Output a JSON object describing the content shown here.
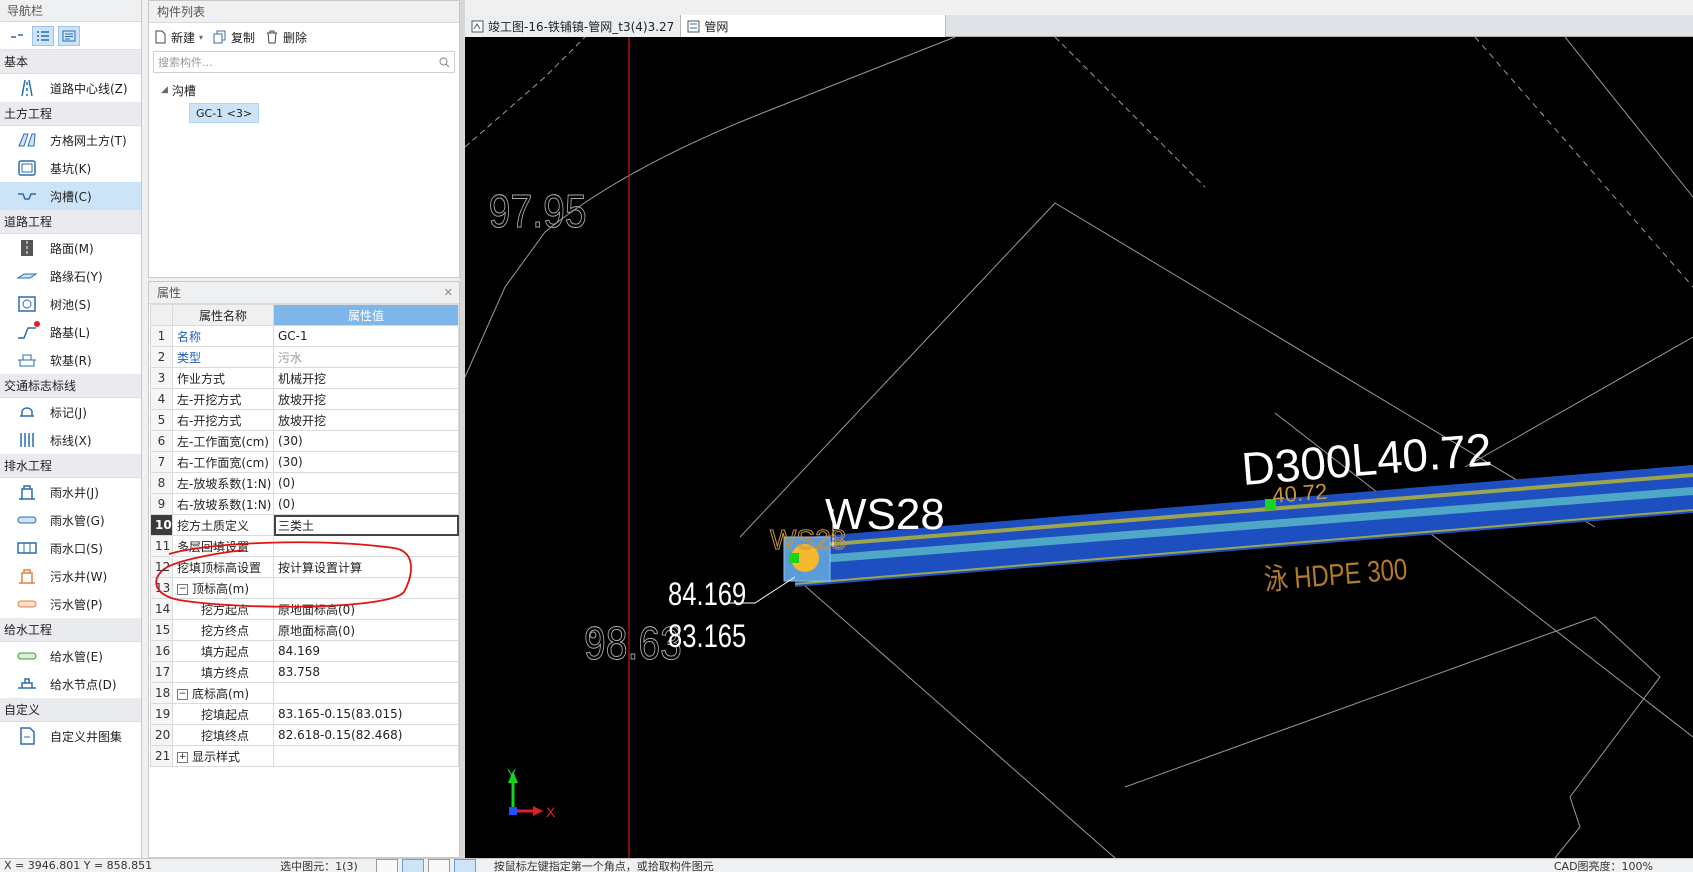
{
  "nav": {
    "title": "导航栏",
    "view_icons": [
      "collapse-icon",
      "list-view-icon",
      "detail-view-icon"
    ],
    "categories": [
      {
        "label": "基本",
        "items": [
          {
            "label": "道路中心线(Z)",
            "icon": "road-centerline-icon"
          }
        ]
      },
      {
        "label": "土方工程",
        "items": [
          {
            "label": "方格网土方(T)",
            "icon": "grid-earthwork-icon"
          },
          {
            "label": "基坑(K)",
            "icon": "foundation-pit-icon"
          },
          {
            "label": "沟槽(C)",
            "icon": "trench-icon",
            "selected": true
          }
        ]
      },
      {
        "label": "道路工程",
        "items": [
          {
            "label": "路面(M)",
            "icon": "pavement-icon"
          },
          {
            "label": "路缘石(Y)",
            "icon": "curb-icon"
          },
          {
            "label": "树池(S)",
            "icon": "tree-pit-icon"
          },
          {
            "label": "路基(L)",
            "icon": "subgrade-icon",
            "badge": true
          },
          {
            "label": "软基(R)",
            "icon": "soft-foundation-icon"
          }
        ]
      },
      {
        "label": "交通标志标线",
        "items": [
          {
            "label": "标记(J)",
            "icon": "marking-icon"
          },
          {
            "label": "标线(X)",
            "icon": "line-marking-icon"
          }
        ]
      },
      {
        "label": "排水工程",
        "items": [
          {
            "label": "雨水井(J)",
            "icon": "rain-well-icon"
          },
          {
            "label": "雨水管(G)",
            "icon": "rain-pipe-icon"
          },
          {
            "label": "雨水口(S)",
            "icon": "rain-inlet-icon"
          },
          {
            "label": "污水井(W)",
            "icon": "sewage-well-icon"
          },
          {
            "label": "污水管(P)",
            "icon": "sewage-pipe-icon"
          }
        ]
      },
      {
        "label": "给水工程",
        "items": [
          {
            "label": "给水管(E)",
            "icon": "water-pipe-icon"
          },
          {
            "label": "给水节点(D)",
            "icon": "water-node-icon"
          }
        ]
      },
      {
        "label": "自定义",
        "items": [
          {
            "label": "自定义井图集",
            "icon": "custom-well-icon"
          }
        ]
      }
    ]
  },
  "components": {
    "title": "构件列表",
    "new_label": "新建",
    "copy_label": "复制",
    "delete_label": "删除",
    "search_placeholder": "搜索构件...",
    "tree_root": "沟槽",
    "tree_leaf": "GC-1 <3>"
  },
  "properties": {
    "title": "属性",
    "header_name": "属性名称",
    "header_value": "属性值",
    "rows": [
      {
        "n": "1",
        "name": "名称",
        "value": "GC-1",
        "style": "blue"
      },
      {
        "n": "2",
        "name": "类型",
        "value": "污水",
        "style": "blue-gray"
      },
      {
        "n": "3",
        "name": "作业方式",
        "value": "机械开挖"
      },
      {
        "n": "4",
        "name": "左-开挖方式",
        "value": "放坡开挖"
      },
      {
        "n": "5",
        "name": "右-开挖方式",
        "value": "放坡开挖"
      },
      {
        "n": "6",
        "name": "左-工作面宽(cm)",
        "value": "(30)"
      },
      {
        "n": "7",
        "name": "右-工作面宽(cm)",
        "value": "(30)"
      },
      {
        "n": "8",
        "name": "左-放坡系数(1:N)",
        "value": "(0)"
      },
      {
        "n": "9",
        "name": "右-放坡系数(1:N)",
        "value": "(0)"
      },
      {
        "n": "10",
        "name": "挖方土质定义",
        "value": "三类土",
        "style": "current"
      },
      {
        "n": "11",
        "name": "多层回填设置",
        "value": ""
      },
      {
        "n": "12",
        "name": "挖填顶标高设置",
        "value": "按计算设置计算"
      },
      {
        "n": "13",
        "name": "顶标高(m)",
        "value": "",
        "group": true
      },
      {
        "n": "14",
        "name": "挖方起点",
        "value": "原地面标高(0)",
        "indent": true
      },
      {
        "n": "15",
        "name": "挖方终点",
        "value": "原地面标高(0)",
        "indent": true
      },
      {
        "n": "16",
        "name": "填方起点",
        "value": "84.169",
        "indent": true
      },
      {
        "n": "17",
        "name": "填方终点",
        "value": "83.758",
        "indent": true
      },
      {
        "n": "18",
        "name": "底标高(m)",
        "value": "",
        "group": true
      },
      {
        "n": "19",
        "name": "挖填起点",
        "value": "83.165-0.15(83.015)",
        "indent": true
      },
      {
        "n": "20",
        "name": "挖填终点",
        "value": "82.618-0.15(82.468)",
        "indent": true
      },
      {
        "n": "21",
        "name": "显示样式",
        "value": "",
        "group": true,
        "collapsed": true
      }
    ]
  },
  "tabs": [
    {
      "label": "竣工图-16-铁铺镇-管网_t3(4)3.27",
      "active": false
    },
    {
      "label": "管网",
      "active": true
    }
  ],
  "cad": {
    "texts": {
      "elev_97": "97.95",
      "elev_98": "98.63",
      "ws28": "WS28",
      "ws28_small": "WS28",
      "pipe_label": "D300L40.72",
      "elev_top": "84.169",
      "elev_bottom": "83.165",
      "hdpe": "HDPE 300",
      "hdpe_prefix": "泳",
      "pipe_small": "40.72",
      "ucs_x": "X",
      "ucs_y": "Y"
    },
    "colors": {
      "background": "#000000",
      "pipe": "#1e5bd6",
      "pipe_core": "#4fa7c8",
      "well": "#f5b82e",
      "annotation": "#e31c1c",
      "vertical_line": "#c81818"
    }
  },
  "status": {
    "coord": "X = 3946.801  Y = 858.851",
    "selection": "选中图元：1(3)",
    "hint": "按鼠标左键指定第一个角点，或拾取构件图元",
    "right": "CAD图亮度：100%"
  }
}
